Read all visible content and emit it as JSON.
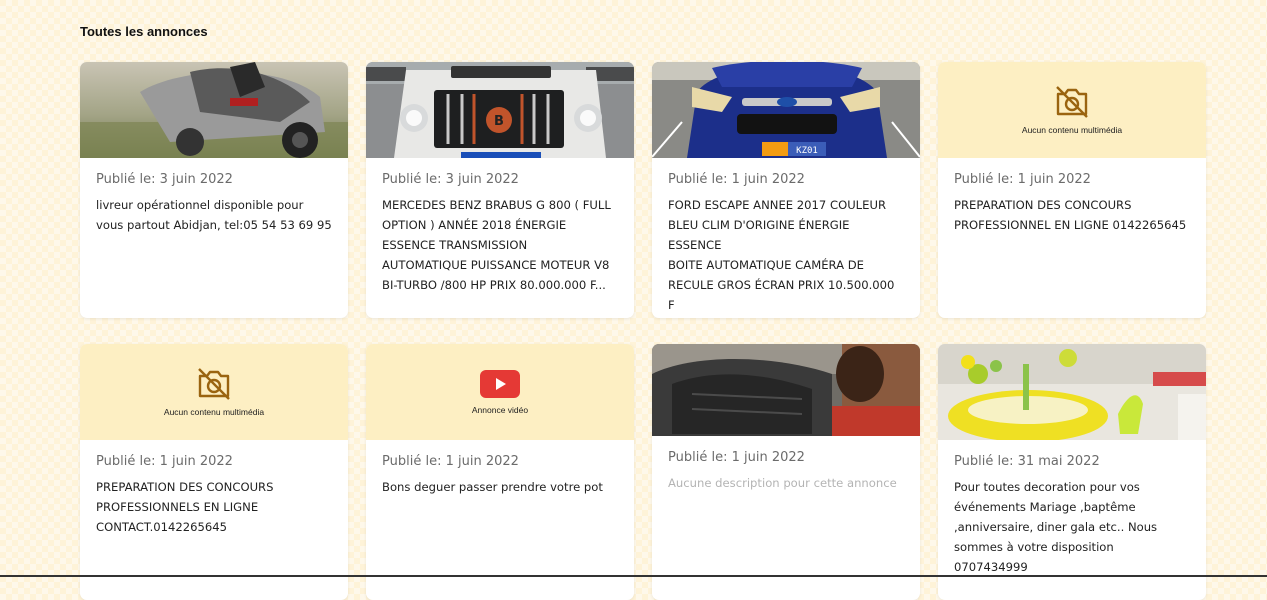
{
  "section": {
    "title": "Toutes les annonces"
  },
  "listings": [
    {
      "date": "Publié le: 3 juin 2022",
      "description": "livreur opérationnel disponible pour\nvous partout Abidjan, tel:05 54 53 69 95",
      "media": "photo-motorcycle"
    },
    {
      "date": "Publié le: 3 juin 2022",
      "description": "MERCEDES BENZ BRABUS G 800 ( FULL\nOPTION ) ANNÉE 2018 ÉNERGIE\nESSENCE TRANSMISSION\nAUTOMATIQUE PUISSANCE MOTEUR V8\nBI-TURBO /800 HP PRIX 80.000.000 F...",
      "media": "photo-mercedes"
    },
    {
      "date": "Publié le: 1 juin 2022",
      "description": "FORD ESCAPE ANNEE 2017 COULEUR\nBLEU CLIM D'ORIGINE ÉNERGIE ESSENCE\nBOITE AUTOMATIQUE CAMÉRA DE\nRECULE GROS ÉCRAN PRIX 10.500.000 F",
      "media": "photo-ford",
      "plate": "KZ01"
    },
    {
      "date": "Publié le: 1 juin 2022",
      "description": "PREPARATION DES CONCOURS\nPROFESSIONNEL EN LIGNE 0142265645",
      "media": "no-media",
      "media_label": "Aucun contenu multimédia"
    },
    {
      "date": "Publié le: 1 juin 2022",
      "description": "PREPARATION DES CONCOURS\nPROFESSIONNELS EN LIGNE\nCONTACT.0142265645",
      "media": "no-media",
      "media_label": "Aucun contenu multimédia"
    },
    {
      "date": "Publié le: 1 juin 2022",
      "description": "Bons deguer passer prendre votre pot",
      "media": "video",
      "media_label": "Annonce vidéo"
    },
    {
      "date": "Publié le: 1 juin 2022",
      "description": "Aucune description pour cette annonce",
      "media": "photo-sofa",
      "muted": true
    },
    {
      "date": "Publié le: 31 mai 2022",
      "description": "Pour toutes decoration pour vos\névénements Mariage ,baptême\n,anniversaire, diner gala etc.. Nous\nsommes à votre disposition 0707434999",
      "media": "photo-decoration"
    }
  ],
  "colors": {
    "placeholder_bg": "#fdefc3",
    "icon_brown": "#9a6410",
    "video_red": "#e53935",
    "page_bg": "#fef3d8"
  },
  "icons": {
    "no_media": "camera-off-icon",
    "video": "play-icon"
  }
}
